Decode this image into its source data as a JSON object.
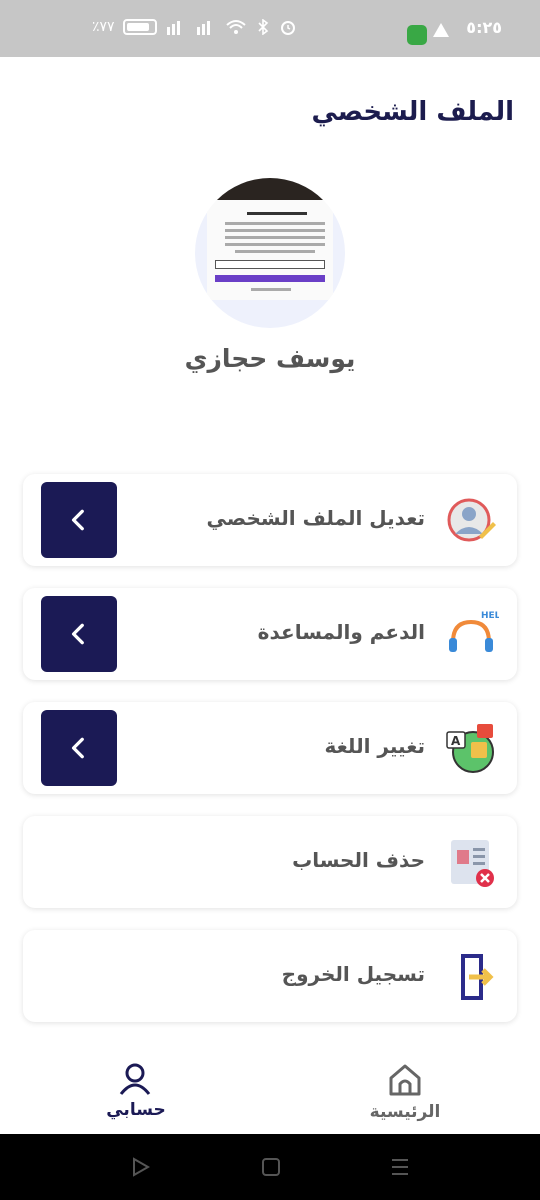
{
  "status_bar": {
    "time": "٥:٢٥",
    "battery": "٪٧٧"
  },
  "header": {
    "title": "الملف الشخصي"
  },
  "profile": {
    "name": "يوسف حجازي"
  },
  "menu": {
    "items": [
      {
        "label": "تعديل الملف الشخصي",
        "icon": "edit-profile-icon",
        "has_arrow": true
      },
      {
        "label": "الدعم والمساعدة",
        "icon": "help-support-icon",
        "has_arrow": true
      },
      {
        "label": "تغيير اللغة",
        "icon": "language-icon",
        "has_arrow": true
      },
      {
        "label": "حذف الحساب",
        "icon": "delete-account-icon",
        "has_arrow": false
      },
      {
        "label": "تسجيل الخروج",
        "icon": "logout-icon",
        "has_arrow": false
      }
    ]
  },
  "bottom_nav": {
    "account_label": "حسابي",
    "home_label": "الرئيسية"
  },
  "colors": {
    "primary": "#1b1a55",
    "title": "#1c1c4e",
    "text": "#555555"
  }
}
